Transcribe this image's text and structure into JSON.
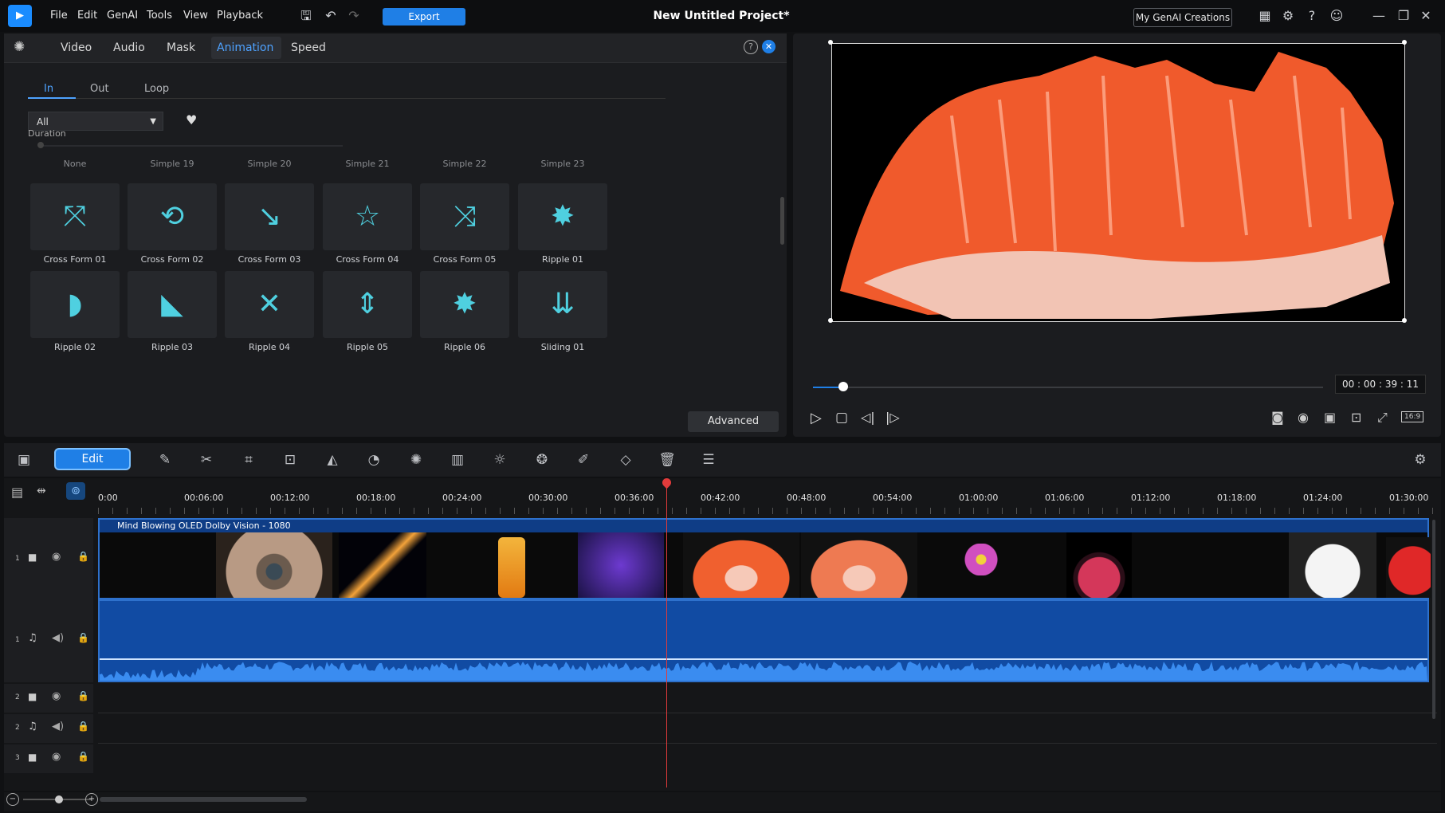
{
  "menu": [
    "File",
    "Edit",
    "GenAI",
    "Tools",
    "View",
    "Playback"
  ],
  "export_label": "Export",
  "project_title": "New Untitled Project*",
  "genai_creations": "My GenAI Creations",
  "panel_tabs": [
    "Video",
    "Audio",
    "Mask",
    "Animation",
    "Speed"
  ],
  "active_tab": "Animation",
  "sub_tabs": [
    "In",
    "Out",
    "Loop"
  ],
  "filter_value": "All",
  "duration_label": "Duration",
  "partial_row": [
    "None",
    "Simple 19",
    "Simple 20",
    "Simple 21",
    "Simple 22",
    "Simple 23"
  ],
  "presets_row1": [
    "Cross Form 01",
    "Cross Form 02",
    "Cross Form 03",
    "Cross Form 04",
    "Cross Form 05",
    "Ripple 01"
  ],
  "presets_row2": [
    "Ripple 02",
    "Ripple 03",
    "Ripple 04",
    "Ripple 05",
    "Ripple 06",
    "Sliding 01"
  ],
  "advanced_label": "Advanced",
  "preview_timecode": "00 : 00 : 39 : 11",
  "preview_progress": 0.06,
  "edit_label": "Edit",
  "ruler": [
    "0:00",
    "00:06:00",
    "00:12:00",
    "00:18:00",
    "00:24:00",
    "00:30:00",
    "00:36:00",
    "00:42:00",
    "00:48:00",
    "00:54:00",
    "01:00:00",
    "01:06:00",
    "01:12:00",
    "01:18:00",
    "01:24:00",
    "01:30:00"
  ],
  "clip_title": "Mind Blowing OLED Dolby Vision - 1080",
  "track_numbers": [
    "1",
    "1",
    "2",
    "2",
    "3"
  ],
  "accent": "#1f7fe6"
}
